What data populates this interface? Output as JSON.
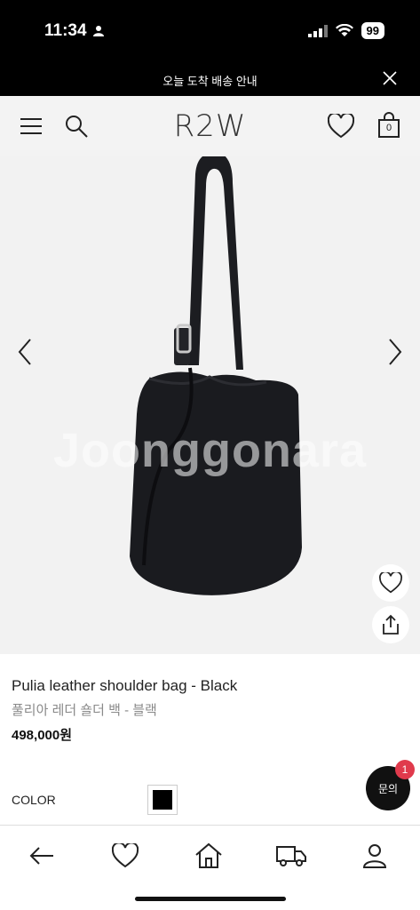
{
  "status_bar": {
    "time": "11:34",
    "battery": "99"
  },
  "notice": {
    "text": "오늘 도착 배송 안내"
  },
  "header": {
    "logo": "R2W",
    "cart_count": "0"
  },
  "product": {
    "watermark": "Joonggonara",
    "name_en": "Pulia leather shoulder bag - Black",
    "name_ko": "풀리아 레더 숄더 백 - 블랙",
    "price": "498,000원",
    "color_label": "COLOR",
    "selected_color": "#000000"
  },
  "chat": {
    "label": "문의",
    "badge": "1"
  },
  "bottom_nav": [
    "back-icon",
    "wishlist-icon",
    "home-icon",
    "delivery-icon",
    "account-icon"
  ]
}
